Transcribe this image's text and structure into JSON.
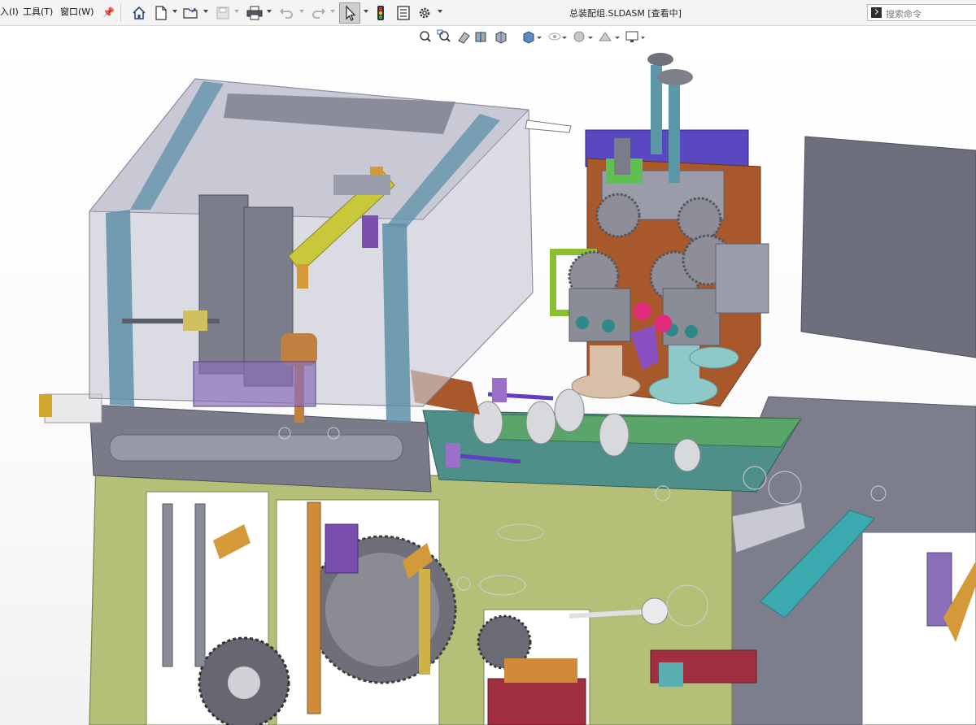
{
  "menu": {
    "view_partial": "入(I)",
    "tools": "工具(T)",
    "window": "窗口(W)"
  },
  "toolbar": {
    "icons": [
      "pin-icon",
      "home-icon",
      "new-document-icon",
      "open-folder-icon",
      "save-icon",
      "print-icon",
      "undo-icon",
      "redo-icon",
      "select-arrow-icon",
      "traffic-light-icon",
      "file-properties-icon",
      "options-gear-icon"
    ]
  },
  "document": {
    "title": "总装配组.SLDASM [查看中]"
  },
  "search": {
    "placeholder": "搜索命令"
  },
  "view_toolbar": {
    "icons": [
      "zoom-to-fit-icon",
      "zoom-to-area-icon",
      "previous-view-icon",
      "section-view-icon",
      "view-orientation-icon",
      "display-style-icon",
      "hide-show-items-icon",
      "edit-appearance-icon",
      "apply-scene-icon",
      "view-settings-icon"
    ]
  },
  "colors": {
    "frame_olive": "#b6bf78",
    "guard_glass": "#c9cad6",
    "steel_blue": "#5d8fa8",
    "plate_gray": "#7d7f8c",
    "rust_orange": "#a8582a",
    "teal": "#5ab0b0",
    "purple": "#7a4fb0"
  }
}
